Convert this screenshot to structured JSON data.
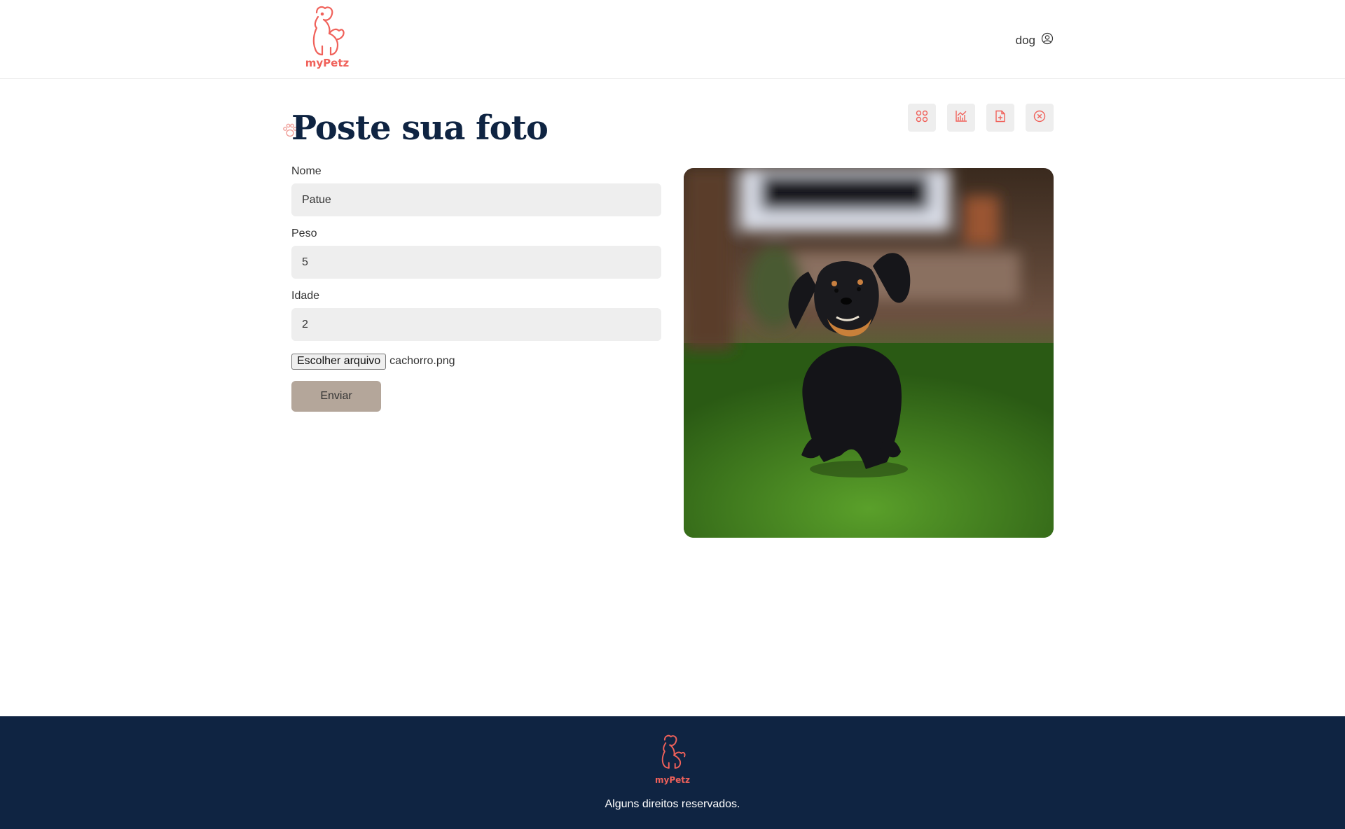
{
  "brand": {
    "name": "myPetz",
    "color": "#f0615a"
  },
  "header": {
    "username": "dog",
    "user_icon": "user-circle-icon"
  },
  "page": {
    "title": "Poste sua foto",
    "title_icon": "paw-icon"
  },
  "actions": [
    {
      "name": "feed-button",
      "icon": "grid-icon"
    },
    {
      "name": "stats-button",
      "icon": "chart-icon"
    },
    {
      "name": "post-photo-button",
      "icon": "add-file-icon"
    },
    {
      "name": "logout-button",
      "icon": "close-circle-icon"
    }
  ],
  "form": {
    "nome": {
      "label": "Nome",
      "value": "Patue"
    },
    "peso": {
      "label": "Peso",
      "value": "5"
    },
    "idade": {
      "label": "Idade",
      "value": "2"
    },
    "file": {
      "button_label": "Escolher arquivo",
      "filename": "cachorro.png"
    },
    "submit_label": "Enviar"
  },
  "photo": {
    "subject": "dachshund running on grass"
  },
  "footer": {
    "text": "Alguns direitos reservados."
  },
  "colors": {
    "navy": "#0f2442",
    "coral": "#f0615a",
    "button": "#b4a69a",
    "input": "#eeeeee"
  }
}
